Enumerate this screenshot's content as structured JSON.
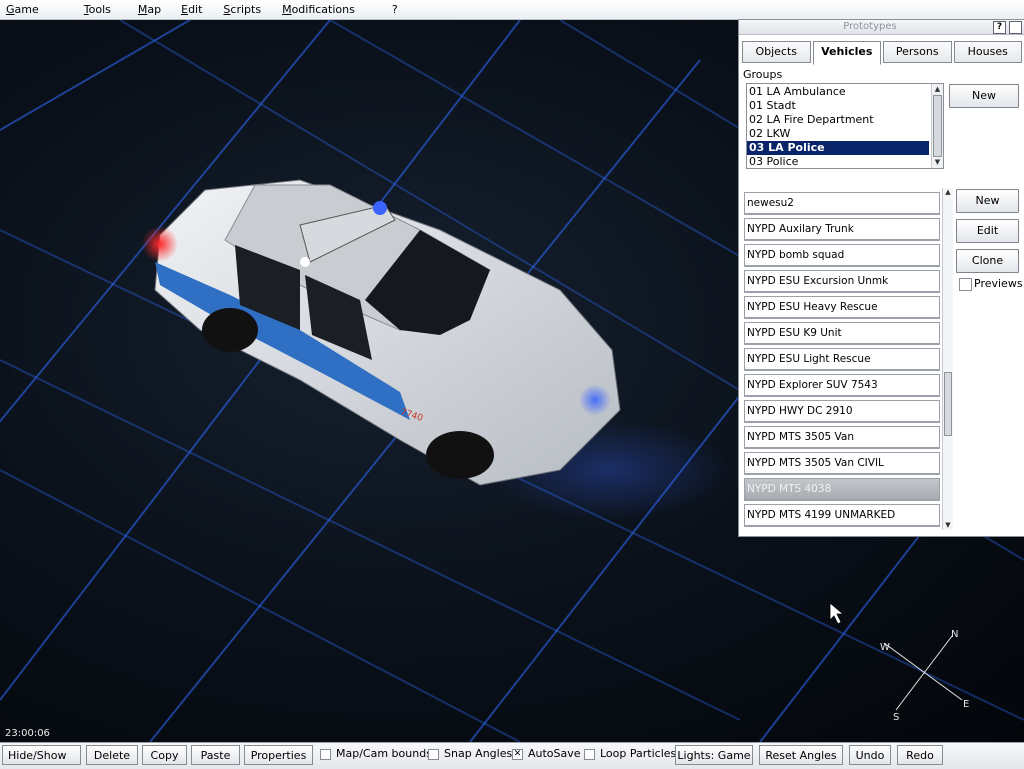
{
  "menu": {
    "items": [
      "Game",
      "Tools",
      "Map",
      "Edit",
      "Scripts",
      "Modifications",
      "?"
    ]
  },
  "viewport": {
    "time": "23:00:06",
    "car_number": "7740",
    "compass": {
      "n": "N",
      "e": "E",
      "s": "S",
      "w": "W"
    },
    "colors": {
      "grid": "#2f6cff",
      "car_body": "#d9dde2",
      "stripe": "#2f6fc4",
      "beacon_blue": "#3a63ff",
      "beacon_red": "#ff2a2a"
    }
  },
  "prototypes": {
    "title": "Prototypes",
    "help_button": "?",
    "tabs": [
      {
        "label": "Objects",
        "active": false
      },
      {
        "label": "Vehicles",
        "active": true
      },
      {
        "label": "Persons",
        "active": false
      },
      {
        "label": "Houses",
        "active": false
      }
    ],
    "groups_label": "Groups",
    "groups": [
      {
        "label": "01 LA Ambulance",
        "selected": false
      },
      {
        "label": "01 Stadt",
        "selected": false
      },
      {
        "label": "02 LA Fire Department",
        "selected": false
      },
      {
        "label": "02 LKW",
        "selected": false
      },
      {
        "label": "03 LA Police",
        "selected": true
      },
      {
        "label": "03 Police",
        "selected": false
      }
    ],
    "group_new_button": "New",
    "vehicles": [
      {
        "label": "newesu2",
        "selected": false
      },
      {
        "label": "NYPD Auxilary Trunk",
        "selected": false
      },
      {
        "label": "NYPD bomb squad",
        "selected": false
      },
      {
        "label": "NYPD ESU Excursion Unmk",
        "selected": false
      },
      {
        "label": "NYPD ESU Heavy Rescue",
        "selected": false
      },
      {
        "label": "NYPD ESU K9 Unit",
        "selected": false
      },
      {
        "label": "NYPD ESU Light Rescue",
        "selected": false
      },
      {
        "label": "NYPD Explorer SUV 7543",
        "selected": false
      },
      {
        "label": "NYPD HWY DC 2910",
        "selected": false
      },
      {
        "label": "NYPD MTS 3505 Van",
        "selected": false
      },
      {
        "label": "NYPD MTS 3505 Van CIVIL",
        "selected": false
      },
      {
        "label": "NYPD MTS 4038",
        "selected": true
      },
      {
        "label": "NYPD MTS 4199 UNMARKED",
        "selected": false
      }
    ],
    "buttons": {
      "new": "New",
      "edit": "Edit",
      "clone": "Clone"
    },
    "previews_label": "Previews",
    "previews_checked": false
  },
  "toolbar": {
    "hide_show": "Hide/Show",
    "delete": "Delete",
    "copy": "Copy",
    "paste": "Paste",
    "properties": "Properties",
    "map_cam_bounds": "Map/Cam bounds",
    "map_cam_bounds_checked": false,
    "snap_angles": "Snap Angles",
    "snap_angles_checked": false,
    "autosave": "AutoSave",
    "autosave_checked": true,
    "loop_particles": "Loop Particles",
    "loop_particles_checked": false,
    "lights": "Lights: Game",
    "reset_angles": "Reset Angles",
    "undo": "Undo",
    "redo": "Redo"
  }
}
